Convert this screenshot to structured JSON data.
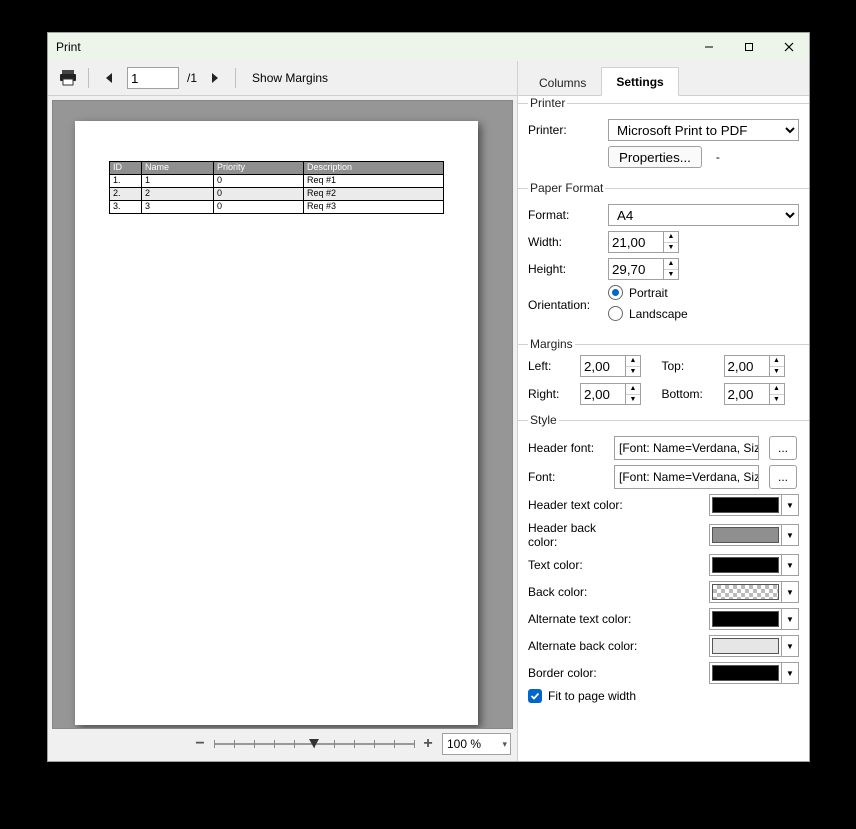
{
  "window": {
    "title": "Print"
  },
  "toolbar": {
    "page_value": "1",
    "page_total": "/1",
    "show_margins": "Show Margins"
  },
  "tabs": {
    "columns": "Columns",
    "settings": "Settings"
  },
  "preview": {
    "columns": [
      "ID",
      "Name",
      "Priority",
      "Description"
    ],
    "rows": [
      {
        "id": "1.",
        "name": "1",
        "priority": "0",
        "desc": "Req #1"
      },
      {
        "id": "2.",
        "name": "2",
        "priority": "0",
        "desc": "Req #2"
      },
      {
        "id": "3.",
        "name": "3",
        "priority": "0",
        "desc": "Req #3"
      }
    ]
  },
  "zoom": {
    "value": "100 %"
  },
  "printer": {
    "legend": "Printer",
    "label": "Printer:",
    "value": "Microsoft Print to PDF",
    "properties": "Properties...",
    "dash": "-"
  },
  "paper": {
    "legend": "Paper Format",
    "format_label": "Format:",
    "format_value": "A4",
    "width_label": "Width:",
    "width_value": "21,00",
    "height_label": "Height:",
    "height_value": "29,70",
    "orient_label": "Orientation:",
    "portrait": "Portrait",
    "landscape": "Landscape"
  },
  "margins": {
    "legend": "Margins",
    "left_label": "Left:",
    "left_value": "2,00",
    "right_label": "Right:",
    "right_value": "2,00",
    "top_label": "Top:",
    "top_value": "2,00",
    "bottom_label": "Bottom:",
    "bottom_value": "2,00"
  },
  "style": {
    "legend": "Style",
    "header_font_label": "Header font:",
    "header_font_value": "[Font: Name=Verdana, Siz",
    "font_label": "Font:",
    "font_value": "[Font: Name=Verdana, Siz",
    "header_text_color": "Header text color:",
    "header_back_color": "Header back color:",
    "text_color": "Text color:",
    "back_color": "Back color:",
    "alt_text_color": "Alternate text color:",
    "alt_back_color": "Alternate back color:",
    "border_color": "Border color:",
    "fit": "Fit to page width"
  }
}
